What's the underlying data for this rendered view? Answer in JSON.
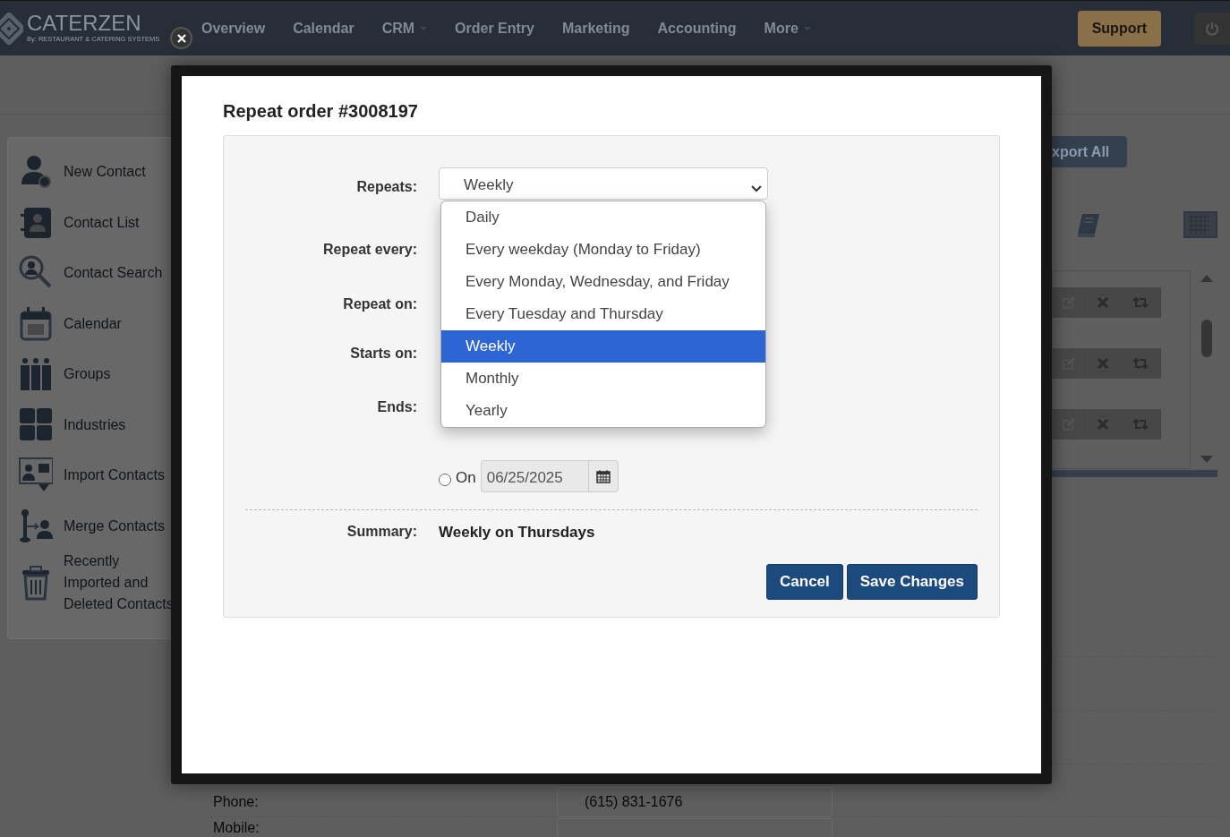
{
  "navbar": {
    "logo": {
      "name": "CATERZEN",
      "tagline": "By: RESTAURANT & CATERING SYSTEMS"
    },
    "menu": [
      {
        "label": "Overview",
        "dropdown": false
      },
      {
        "label": "Calendar",
        "dropdown": false
      },
      {
        "label": "CRM",
        "dropdown": true
      },
      {
        "label": "Order Entry",
        "dropdown": false
      },
      {
        "label": "Marketing",
        "dropdown": false
      },
      {
        "label": "Accounting",
        "dropdown": false
      },
      {
        "label": "More",
        "dropdown": true
      }
    ],
    "support_button": "Support"
  },
  "sidebar": {
    "items": [
      {
        "label": "New Contact"
      },
      {
        "label": "Contact List"
      },
      {
        "label": "Contact Search"
      },
      {
        "label": "Calendar"
      },
      {
        "label": "Groups"
      },
      {
        "label": "Industries"
      },
      {
        "label": "Import Contacts"
      },
      {
        "label": "Merge Contacts"
      },
      {
        "label": "Recently Imported and Deleted Contacts"
      }
    ]
  },
  "export_button": "xport All",
  "contact_fields": [
    {
      "label": "Phone:",
      "value": "(615) 831-1676"
    },
    {
      "label": "Mobile:"
    }
  ],
  "modal": {
    "title": "Repeat order #3008197",
    "fields": [
      {
        "label": "Repeats:"
      },
      {
        "label": "Repeat every:"
      },
      {
        "label": "Repeat on:"
      },
      {
        "label": "Starts on:"
      },
      {
        "label": "Ends:"
      }
    ],
    "repeats_value": "Weekly",
    "options": [
      {
        "label": "Daily",
        "selected": false
      },
      {
        "label": "Every weekday (Monday to Friday)",
        "selected": false
      },
      {
        "label": "Every Monday, Wednesday, and Friday",
        "selected": false
      },
      {
        "label": "Every Tuesday and Thursday",
        "selected": false
      },
      {
        "label": "Weekly",
        "selected": true
      },
      {
        "label": "Monthly",
        "selected": false
      },
      {
        "label": "Yearly",
        "selected": false
      }
    ],
    "end_on": {
      "label": "On",
      "checked": false,
      "value": "06/25/2025"
    },
    "summary": {
      "label": "Summary:",
      "text": "Weekly on Thursdays"
    },
    "buttons": [
      {
        "label": "Cancel"
      },
      {
        "label": "Save Changes"
      }
    ]
  }
}
